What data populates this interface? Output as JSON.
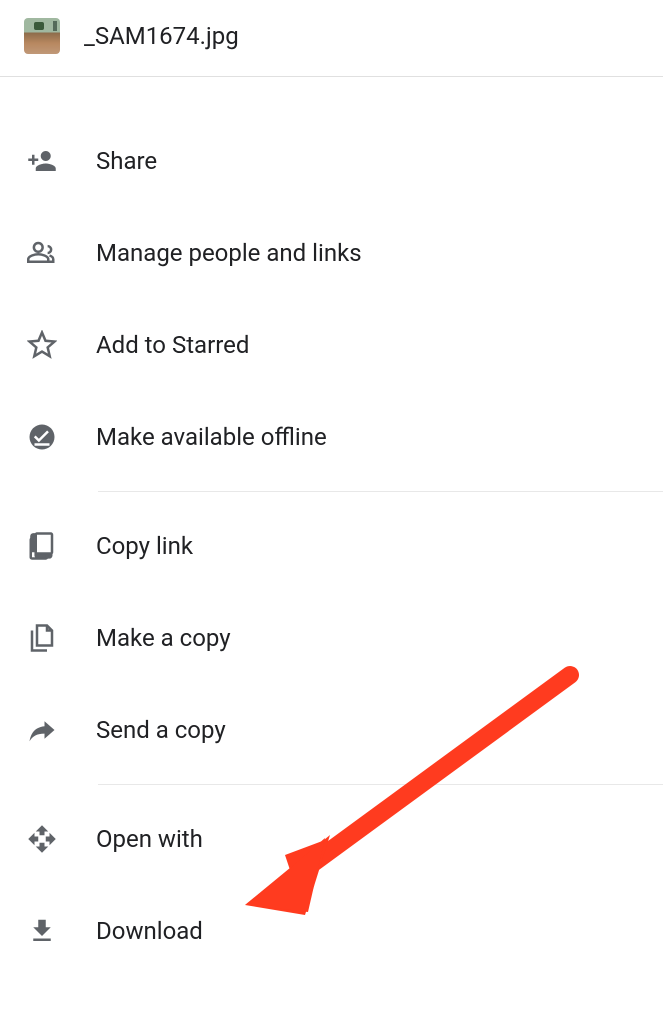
{
  "header": {
    "filename": "_SAM1674.jpg"
  },
  "menu": {
    "share": "Share",
    "manage": "Manage people and links",
    "starred": "Add to Starred",
    "offline": "Make available offline",
    "copylink": "Copy link",
    "makecopy": "Make a copy",
    "sendcopy": "Send a copy",
    "openwith": "Open with",
    "download": "Download"
  }
}
